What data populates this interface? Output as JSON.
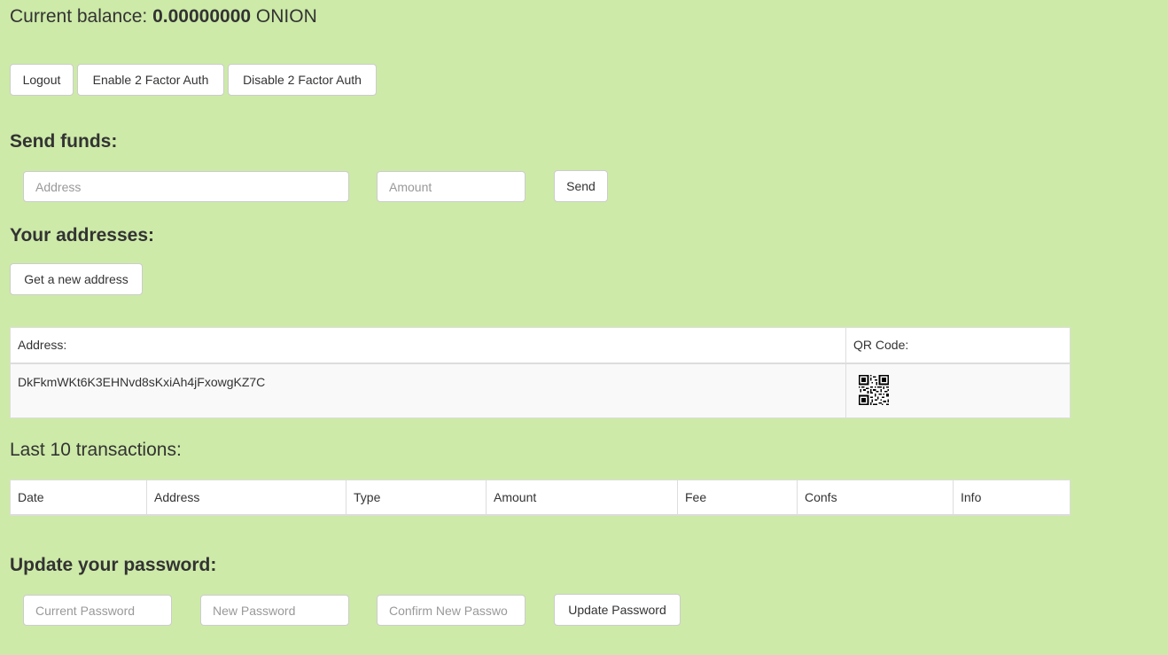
{
  "balance": {
    "label": "Current balance:",
    "amount": "0.00000000",
    "currency": "ONION"
  },
  "account_actions": {
    "logout_label": "Logout",
    "enable_2fa_label": "Enable 2 Factor Auth",
    "disable_2fa_label": "Disable 2 Factor Auth"
  },
  "send_funds": {
    "heading": "Send funds:",
    "address_placeholder": "Address",
    "amount_placeholder": "Amount",
    "send_label": "Send"
  },
  "addresses": {
    "heading": "Your addresses:",
    "new_address_label": "Get a new address",
    "columns": [
      "Address:",
      "QR Code:"
    ],
    "rows": [
      {
        "address": "DkFkmWKt6K3EHNvd8sKxiAh4jFxowgKZ7C",
        "qr_icon": "qr-code-icon"
      }
    ]
  },
  "transactions": {
    "heading": "Last 10 transactions:",
    "columns": [
      "Date",
      "Address",
      "Type",
      "Amount",
      "Fee",
      "Confs",
      "Info"
    ],
    "rows": []
  },
  "password": {
    "heading": "Update your password:",
    "current_placeholder": "Current Password",
    "new_placeholder": "New Password",
    "confirm_placeholder": "Confirm New Passwo",
    "update_label": "Update Password"
  },
  "colors": {
    "background": "#cdeaa8",
    "button_bg": "#ffffff",
    "border": "#cccccc",
    "text": "#333333"
  }
}
